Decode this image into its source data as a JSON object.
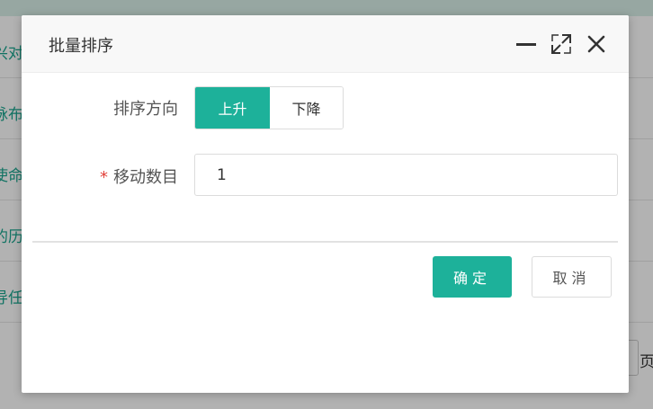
{
  "background": {
    "rows": [
      "兴对",
      "脉布",
      "使命",
      "的历",
      "导任"
    ],
    "pager_suffix": "页"
  },
  "dialog": {
    "title": "批量排序",
    "sort_direction": {
      "label": "排序方向",
      "options": [
        "上升",
        "下降"
      ],
      "selected": "上升"
    },
    "move_count": {
      "required_mark": "*",
      "label": "移动数目",
      "value": "1"
    },
    "buttons": {
      "confirm": "确定",
      "cancel": "取消"
    },
    "header_icons": [
      "minimize-icon",
      "maximize-icon",
      "close-icon"
    ]
  },
  "colors": {
    "accent": "#1db19a",
    "required": "#e2413a"
  }
}
